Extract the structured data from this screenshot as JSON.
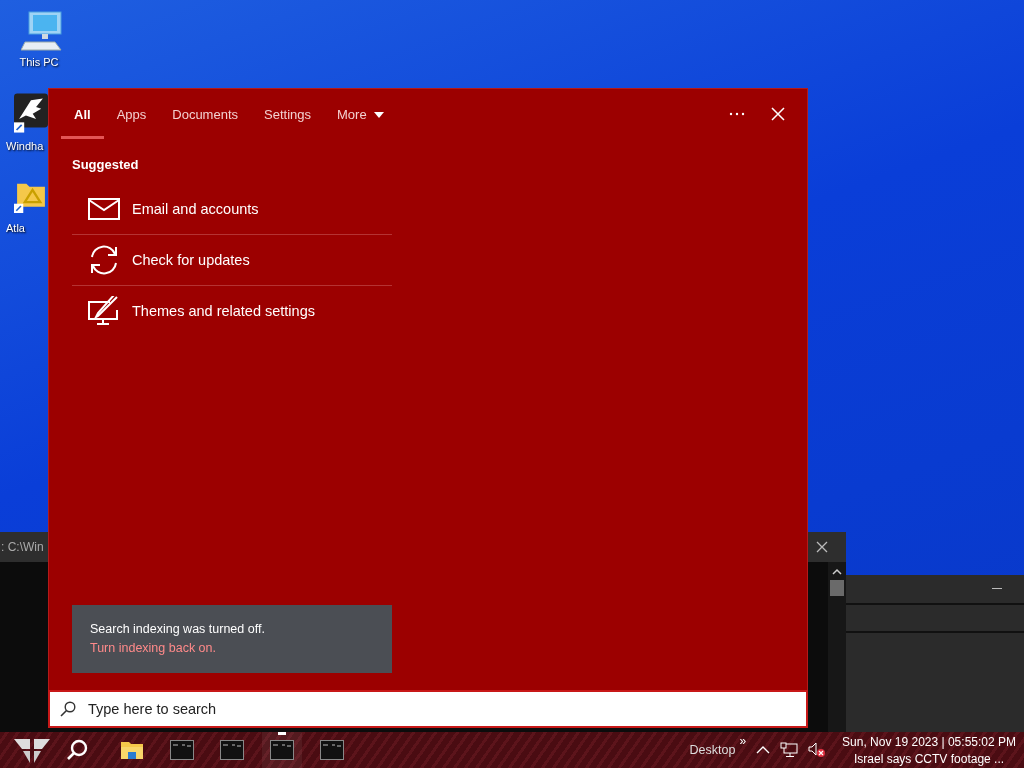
{
  "desktop_icons": [
    {
      "label": "This PC",
      "kind": "computer"
    },
    {
      "label": "Windha",
      "kind": "eagle"
    },
    {
      "label": "Atla",
      "kind": "folder"
    }
  ],
  "background_windows": [
    {
      "title": ": C:\\Win",
      "kind": "console"
    },
    {
      "kind": "blank"
    }
  ],
  "search_panel": {
    "tabs": [
      {
        "label": "All",
        "selected": true,
        "has_menu": false
      },
      {
        "label": "Apps",
        "selected": false,
        "has_menu": false
      },
      {
        "label": "Documents",
        "selected": false,
        "has_menu": false
      },
      {
        "label": "Settings",
        "selected": false,
        "has_menu": false
      },
      {
        "label": "More",
        "selected": false,
        "has_menu": true
      }
    ],
    "section_title": "Suggested",
    "suggestions": [
      {
        "label": "Email and accounts",
        "kind": "mail"
      },
      {
        "label": "Check for updates",
        "kind": "sync"
      },
      {
        "label": "Themes and related settings",
        "kind": "paint"
      }
    ],
    "notice": {
      "text": "Search indexing was turned off.",
      "link": "Turn indexing back on."
    },
    "search_field": {
      "placeholder": "Type here to search"
    }
  },
  "taskbar": {
    "apps": [
      {
        "kind": "folder",
        "running": false
      },
      {
        "kind": "console",
        "running": false
      },
      {
        "kind": "console",
        "running": false
      },
      {
        "kind": "console",
        "running": true
      },
      {
        "kind": "console",
        "running": false
      }
    ],
    "toolbar_label": "Desktop",
    "toolbar_chevron": "»",
    "clock": {
      "date_time": "Sun, Nov 19 2023 | 05:55:02 PM",
      "news": "Israel says CCTV footage ..."
    }
  }
}
